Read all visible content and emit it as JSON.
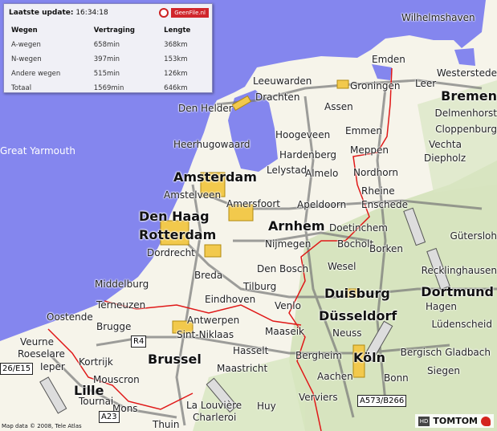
{
  "panel": {
    "update_label": "Laatste update:",
    "update_time": "16:34:18",
    "geenfile_label": "GeenFile.nl",
    "headers": [
      "Wegen",
      "Vertraging",
      "Lengte"
    ],
    "rows": [
      [
        "A-wegen",
        "658min",
        "368km"
      ],
      [
        "N-wegen",
        "397min",
        "153km"
      ],
      [
        "Andere wegen",
        "515min",
        "126km"
      ],
      [
        "Totaal",
        "1569min",
        "646km"
      ]
    ]
  },
  "cities": [
    "Wilhelmshaven",
    "Emden",
    "Leer",
    "Westerstede",
    "Leeuwarden",
    "Groningen",
    "Drachten",
    "Assen",
    "Den Helder",
    "Emmen",
    "Heerhugowaard",
    "Hoogeveen",
    "Hardenberg",
    "Meppen",
    "Amsterdam",
    "Lelystad",
    "Almelo",
    "Nordhorn",
    "Amstelveen",
    "Apeldoorn",
    "Enschede",
    "Rheine",
    "Den Haag",
    "Amersfoort",
    "Arnhem",
    "Rotterdam",
    "Doetinchem",
    "Nijmegen",
    "Bocholt",
    "Borken",
    "Dordrecht",
    "Den Bosch",
    "Wesel",
    "Middelburg",
    "Breda",
    "Tilburg",
    "Duisburg",
    "Dortmund",
    "Terneuzen",
    "Eindhoven",
    "Venlo",
    "Düsseldorf",
    "Hagen",
    "Oostende",
    "Brugge",
    "Antwerpen",
    "Sint-Niklaas",
    "Maaseik",
    "Lüdenscheid",
    "Veurne",
    "Roeselare",
    "Hasselt",
    "Neuss",
    "Bergisch Gladbach",
    "Ieper",
    "Kortrijk",
    "Brussel",
    "Maastricht",
    "Bergheim",
    "Köln",
    "Mouscron",
    "Aachen",
    "Bonn",
    "Siegen",
    "Lille",
    "Tournai",
    "Mons",
    "La Louvière",
    "Huy",
    "Verviers",
    "Charleroi",
    "Thuin",
    "Great Yarmouth",
    "Bremen",
    "Delmenhorst",
    "Cloppenburg",
    "Vechta",
    "Diepholz",
    "Gütersloh",
    "Recklinghausen"
  ],
  "shields": [
    "R4",
    "A23",
    "A573/B266",
    "26/E15"
  ],
  "credit": "Map data © 2008, Tele Atlas",
  "logo": {
    "hd": "HD",
    "brand": "TOMTOM"
  },
  "colors": {
    "sea": "#8486ee",
    "land": "#f6f4ea",
    "green": "#cfe0b4",
    "border": "#e01818",
    "jam": "#f2c94c"
  }
}
